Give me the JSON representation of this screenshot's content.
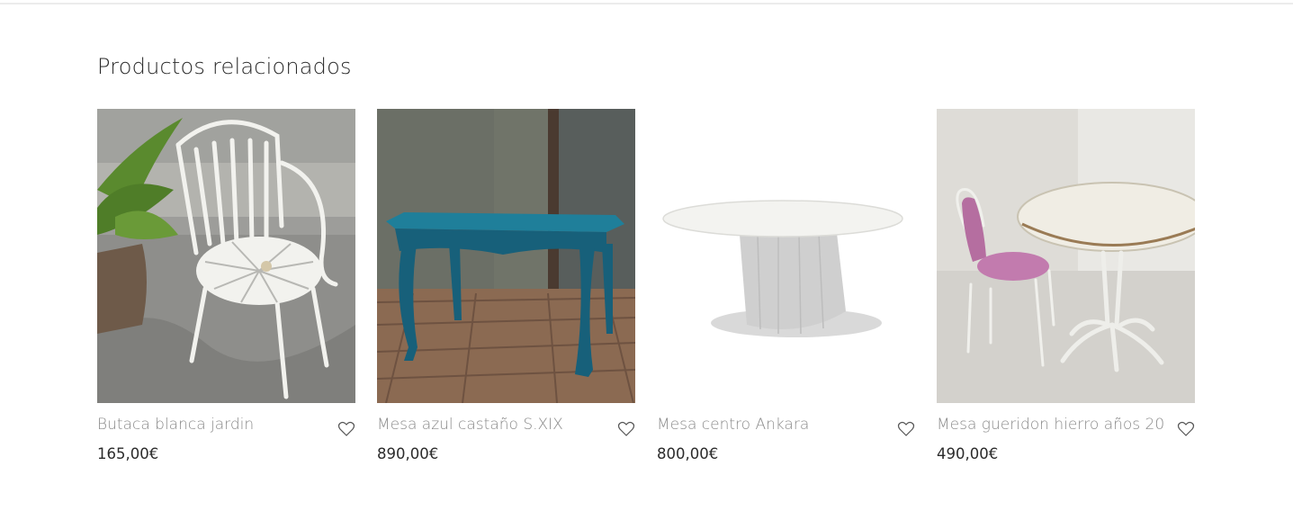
{
  "section": {
    "title": "Productos relacionados"
  },
  "products": [
    {
      "name": "Butaca blanca jardin",
      "price": "165,00€",
      "image": "white-garden-chair-photo",
      "wishlist_icon": "heart-outline-icon"
    },
    {
      "name": "Mesa azul castaño S.XIX",
      "price": "890,00€",
      "image": "blue-chestnut-table-photo",
      "wishlist_icon": "heart-outline-icon"
    },
    {
      "name": "Mesa centro Ankara",
      "price": "800,00€",
      "image": "white-oval-coffee-table-photo",
      "wishlist_icon": "heart-outline-icon"
    },
    {
      "name": "Mesa gueridon hierro años 20",
      "price": "490,00€",
      "image": "iron-gueridon-table-photo",
      "wishlist_icon": "heart-outline-icon"
    }
  ],
  "colors": {
    "title": "#2b2b2b",
    "product_name": "#8a8a8a",
    "price": "#2b2b2b",
    "rule": "#ececec"
  }
}
